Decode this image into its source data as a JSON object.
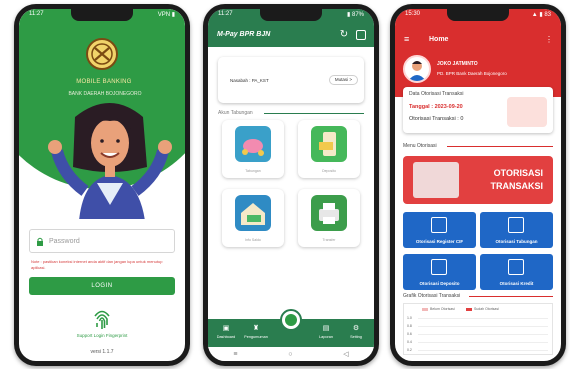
{
  "login_screen": {
    "status_left": "11:27",
    "status_right": "VPN ▮",
    "app_title": "MOBILE BANKING",
    "app_subtitle": "BANK DAERAH BOJONEGORO",
    "password_placeholder": "Password",
    "warning_text": "Note : pastikan koneksi internet anda aktif dan jangan lupa untuk menutup aplikasi.",
    "login_label": "LOGIN",
    "fingerprint_label": "Support Login Fingerprint",
    "version": "versi 1.1.7"
  },
  "dashboard_screen": {
    "status_left": "11:27",
    "status_right": "▮ 87%",
    "title": "M-Pay BPR BJN",
    "refresh_icon": "refresh-icon",
    "exit_icon": "exit-icon",
    "kode_label": "Nasabah : PA_KST",
    "mutasi_label": "Mutasi >",
    "section_label": "Akun Tabungan",
    "tiles": [
      {
        "label": "Tabungan",
        "color": "#3aa0c9"
      },
      {
        "label": "Deposito",
        "color": "#45b85a"
      },
      {
        "label": "Info Saldo",
        "color": "#2f8bc4"
      },
      {
        "label": "Transfer",
        "color": "#3c9d4b"
      }
    ],
    "nav": [
      {
        "label": "Dashboard",
        "glyph": "▣"
      },
      {
        "label": "Pengumuman",
        "glyph": "♜"
      },
      {
        "label": "Laporan",
        "glyph": "▤"
      },
      {
        "label": "Setting",
        "glyph": "⚙"
      }
    ],
    "system_nav": [
      "≡",
      "○",
      "◁"
    ]
  },
  "home_screen": {
    "status_left": "15:30",
    "status_right": "▲ ▮ 83",
    "title": "Home",
    "user_name": "JOKO JATMINTO",
    "bank_name": "PD. BPR Bank Daerah Bojonegoro",
    "data_label": "Data Otorisasi Transaksi",
    "date_label": "Tanggal : 2023-09-20",
    "otorisasi_label": "Otorisasi Transaksi : 0",
    "menu_label": "Menu Otorisasi",
    "banner_line1": "OTORISASI",
    "banner_line2": "TRANSAKSI",
    "buttons": [
      {
        "label": "Otorisasi Register CIF"
      },
      {
        "label": "Otorisasi Tabungan"
      },
      {
        "label": "Otorisasi Deposito"
      },
      {
        "label": "Otorisasi Kredit"
      }
    ],
    "chart_title": "Grafik Otorisasi Transaksi",
    "legend": [
      {
        "label": "Belum Otorisasi",
        "color": "#f2b8b8"
      },
      {
        "label": "Sudah Otorisasi",
        "color": "#e24040"
      }
    ],
    "y_ticks": [
      "1.0",
      "0.8",
      "0.6",
      "0.4",
      "0.2"
    ]
  },
  "colors": {
    "green_brand": "#2e9b45",
    "green_dark": "#2a7d4f",
    "red_brand": "#d92e2e",
    "blue_button": "#1f67c6"
  }
}
